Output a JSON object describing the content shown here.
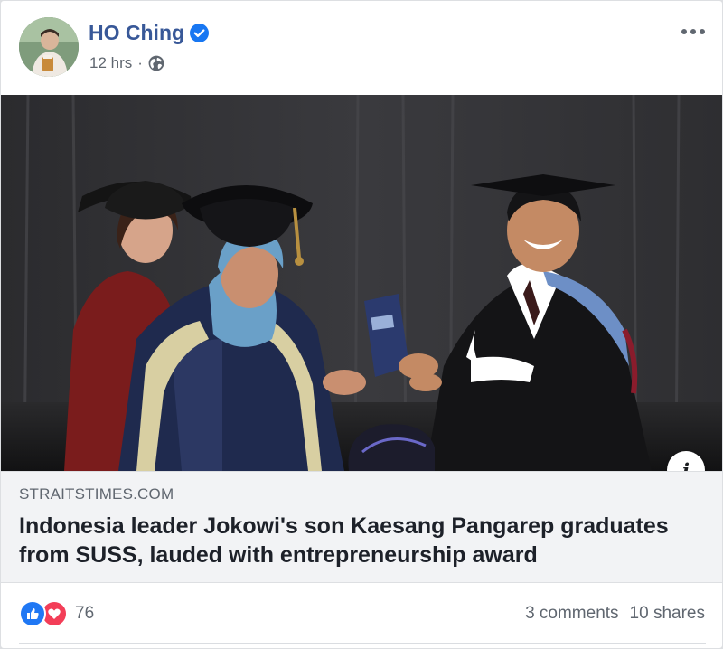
{
  "post": {
    "author": "HO Ching",
    "time": "12 hrs",
    "separator": "·",
    "privacy_icon": "globe-icon",
    "verified_icon": "verified-badge-icon",
    "more_icon": "more-options-icon"
  },
  "link": {
    "domain": "STRAITSTIMES.COM",
    "headline": "Indonesia leader Jokowi's son Kaesang Pangarep graduates from SUSS, lauded with entrepreneurship award",
    "info_label": "i"
  },
  "engagement": {
    "reaction_icons": [
      "like-reaction-icon",
      "love-reaction-icon"
    ],
    "reaction_count": "76",
    "comments": "3 comments",
    "shares": "10 shares"
  },
  "colors": {
    "link_blue": "#385898",
    "verified": "#1877f2",
    "like": "#2078f4",
    "love": "#f33e58",
    "meta_grey": "#606770"
  }
}
